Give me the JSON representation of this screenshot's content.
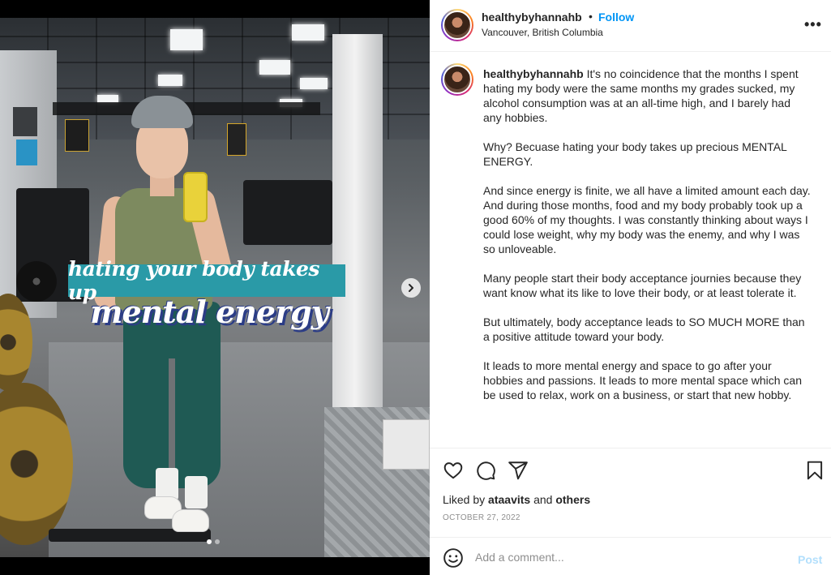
{
  "media": {
    "overlay_line1": "hating your body takes up",
    "overlay_line2": "mental energy",
    "slide_count": 2,
    "active_slide": 1
  },
  "header": {
    "username": "healthybyhannahb",
    "separator": "•",
    "follow_label": "Follow",
    "location": "Vancouver, British Columbia",
    "more_label": "•••"
  },
  "caption": {
    "username": "healthybyhannahb",
    "paragraphs": [
      "It's no coincidence that the months I spent hating my body were the same months my grades sucked, my alcohol consumption was at an all-time high, and I barely had any hobbies.",
      "Why? Becuase hating your body takes up precious MENTAL ENERGY.",
      "And since energy is finite, we all have a limited amount each day. And during those months, food and my body probably took up a good 60% of my thoughts. I was constantly thinking about ways I could lose weight, why my body was the enemy, and why I was so unloveable.",
      "Many people start their body acceptance journies because they want know what its like to love their body, or at least tolerate it.",
      "But ultimately, body acceptance leads to SO MUCH MORE than a positive attitude toward your body.",
      "It leads to more mental energy and space to go after your hobbies and passions. It leads to more mental space which can be used to relax, work on a business, or start that new hobby."
    ]
  },
  "actions": {
    "liked_prefix": "Liked by",
    "liked_user": "ataavits",
    "liked_and": "and",
    "liked_others": "others",
    "date": "OCTOBER 27, 2022"
  },
  "comment": {
    "placeholder": "Add a comment...",
    "post_label": "Post"
  },
  "colors": {
    "follow_blue": "#0095f6",
    "post_disabled": "#b2dffc",
    "overlay_teal": "#2a9aa7",
    "overlay_shadow": "#2b3c86"
  },
  "icons": [
    "heart-icon",
    "comment-icon",
    "share-icon",
    "bookmark-icon",
    "emoji-icon",
    "chevron-right-icon",
    "more-icon"
  ]
}
